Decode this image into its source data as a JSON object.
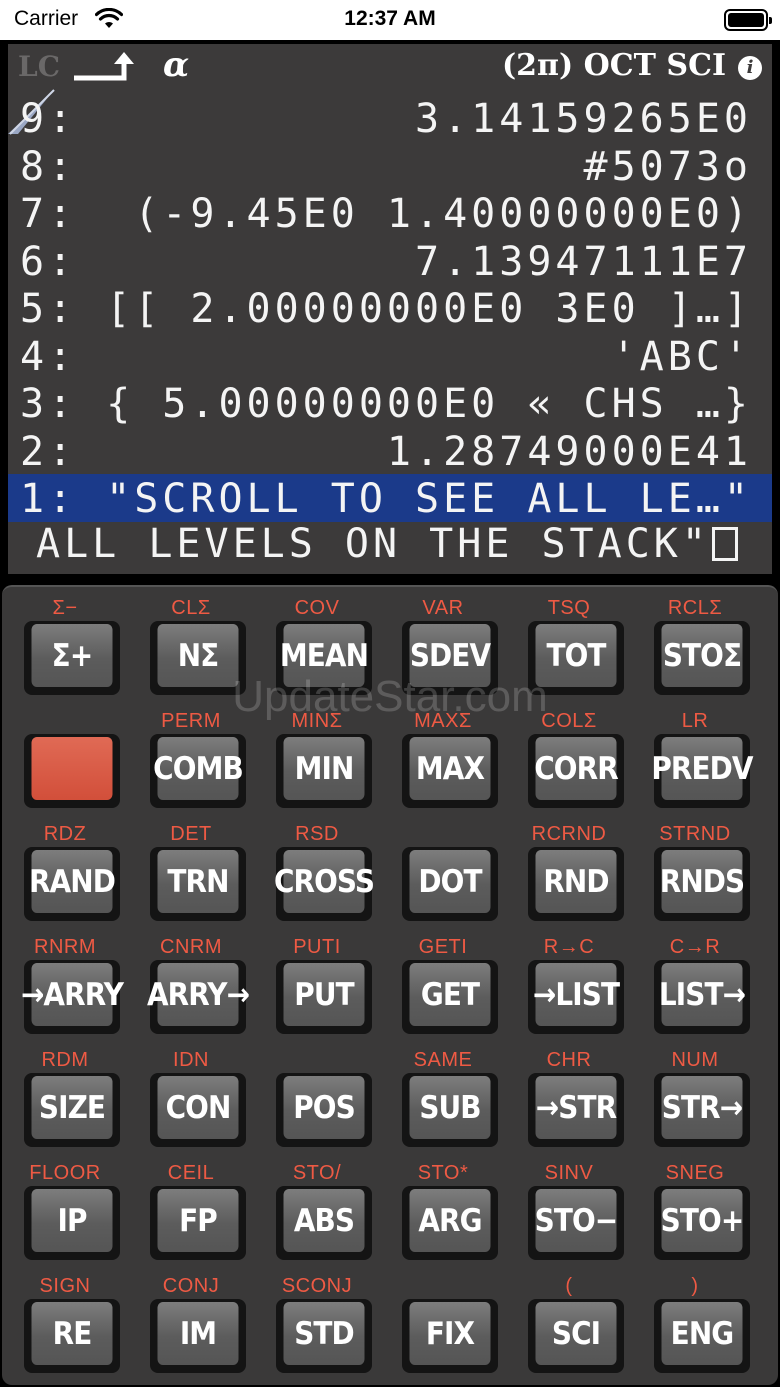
{
  "status_bar": {
    "carrier": "Carrier",
    "time": "12:37 AM"
  },
  "annunciators": {
    "lc": "LC",
    "alpha": "α",
    "modes": "(2π) OCT SCI",
    "info": "i"
  },
  "stack": [
    {
      "level": "9:",
      "value": "3.14159265E0"
    },
    {
      "level": "8:",
      "value": "#5073o"
    },
    {
      "level": "7:",
      "value": "(-9.45E0 1.40000000E0)"
    },
    {
      "level": "6:",
      "value": "7.13947111E7"
    },
    {
      "level": "5:",
      "value": "[[ 2.00000000E0 3E0 ]…]"
    },
    {
      "level": "4:",
      "value": "'ABC'"
    },
    {
      "level": "3:",
      "value": "{ 5.00000000E0 « CHS …}"
    },
    {
      "level": "2:",
      "value": "1.28749000E41"
    },
    {
      "level": "1:",
      "value": "\"SCROLL TO SEE ALL LE…\""
    }
  ],
  "command_line": "ALL LEVELS ON THE STACK\"",
  "watermark": "UpdateStar.com",
  "keys": [
    [
      {
        "shift": "Σ−",
        "label": "Σ+"
      },
      {
        "shift": "CLΣ",
        "label": "NΣ"
      },
      {
        "shift": "COV",
        "label": "MEAN"
      },
      {
        "shift": "VAR",
        "label": "SDEV"
      },
      {
        "shift": "TSQ",
        "label": "TOT"
      },
      {
        "shift": "RCLΣ",
        "label": "STOΣ"
      }
    ],
    [
      {
        "shift": "",
        "label": "",
        "orange": true
      },
      {
        "shift": "PERM",
        "label": "COMB"
      },
      {
        "shift": "MINΣ",
        "label": "MIN"
      },
      {
        "shift": "MAXΣ",
        "label": "MAX"
      },
      {
        "shift": "COLΣ",
        "label": "CORR"
      },
      {
        "shift": "LR",
        "label": "PREDV"
      }
    ],
    [
      {
        "shift": "RDZ",
        "label": "RAND"
      },
      {
        "shift": "DET",
        "label": "TRN"
      },
      {
        "shift": "RSD",
        "label": "CROSS"
      },
      {
        "shift": "",
        "label": "DOT"
      },
      {
        "shift": "RCRND",
        "label": "RND"
      },
      {
        "shift": "STRND",
        "label": "RNDS"
      }
    ],
    [
      {
        "shift": "RNRM",
        "label": "→ARRY"
      },
      {
        "shift": "CNRM",
        "label": "ARRY→"
      },
      {
        "shift": "PUTI",
        "label": "PUT"
      },
      {
        "shift": "GETI",
        "label": "GET"
      },
      {
        "shift": "R→C",
        "label": "→LIST"
      },
      {
        "shift": "C→R",
        "label": "LIST→"
      }
    ],
    [
      {
        "shift": "RDM",
        "label": "SIZE"
      },
      {
        "shift": "IDN",
        "label": "CON"
      },
      {
        "shift": "",
        "label": "POS"
      },
      {
        "shift": "SAME",
        "label": "SUB"
      },
      {
        "shift": "CHR",
        "label": "→STR"
      },
      {
        "shift": "NUM",
        "label": "STR→"
      }
    ],
    [
      {
        "shift": "FLOOR",
        "label": "IP"
      },
      {
        "shift": "CEIL",
        "label": "FP"
      },
      {
        "shift": "STO/",
        "label": "ABS"
      },
      {
        "shift": "STO*",
        "label": "ARG"
      },
      {
        "shift": "SINV",
        "label": "STO−"
      },
      {
        "shift": "SNEG",
        "label": "STO+"
      }
    ],
    [
      {
        "shift": "SIGN",
        "label": "RE"
      },
      {
        "shift": "CONJ",
        "label": "IM"
      },
      {
        "shift": "SCONJ",
        "label": "STD"
      },
      {
        "shift": "",
        "label": "FIX"
      },
      {
        "shift": "(",
        "label": "SCI"
      },
      {
        "shift": ")",
        "label": "ENG"
      }
    ]
  ]
}
